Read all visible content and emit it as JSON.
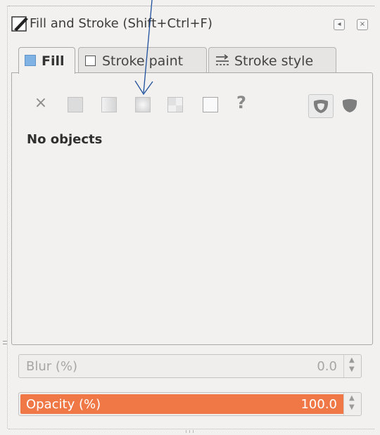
{
  "window": {
    "title": "Fill and Stroke (Shift+Ctrl+F)"
  },
  "tabs": [
    {
      "label": "Fill",
      "active": true
    },
    {
      "label": "Stroke paint",
      "active": false
    },
    {
      "label": "Stroke style",
      "active": false
    }
  ],
  "paint_types": [
    {
      "name": "no-paint",
      "glyph": "×"
    },
    {
      "name": "flat-color"
    },
    {
      "name": "linear-gradient"
    },
    {
      "name": "radial-gradient"
    },
    {
      "name": "pattern"
    },
    {
      "name": "swatch"
    },
    {
      "name": "unset",
      "glyph": "?"
    }
  ],
  "fill_rules": [
    "evenodd",
    "nonzero"
  ],
  "status": {
    "message": "No objects"
  },
  "blur": {
    "label": "Blur (%)",
    "value": "0.0"
  },
  "opacity": {
    "label": "Opacity (%)",
    "value": "100.0",
    "fraction": 1.0
  },
  "colors": {
    "opacity_bar": "#f07846",
    "fill_tab_icon": "#80b2e3",
    "annotation_arrow": "#1d4f9c"
  }
}
